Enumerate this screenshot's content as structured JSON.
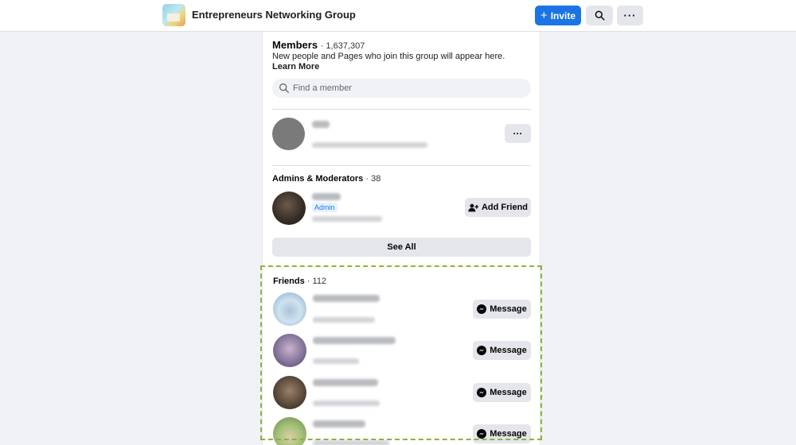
{
  "header": {
    "group_name": "Entrepreneurs Networking Group",
    "invite_label": "Invite",
    "search_icon": "search-icon",
    "more_icon": "more-icon"
  },
  "members": {
    "title": "Members",
    "count": "· 1,637,307",
    "description": "New people and Pages who join this group will appear here.",
    "learn_more": "Learn More",
    "search_placeholder": "Find a member"
  },
  "admins": {
    "title": "Admins & Moderators",
    "count": "· 38",
    "badge": "Admin",
    "add_friend_label": "Add Friend",
    "see_all_label": "See All"
  },
  "friends": {
    "title": "Friends",
    "count": "· 112",
    "message_label": "Message"
  },
  "colors": {
    "accent": "#1b74e4",
    "highlight_border": "#8cb33b",
    "button_gray": "#e4e6eb"
  }
}
